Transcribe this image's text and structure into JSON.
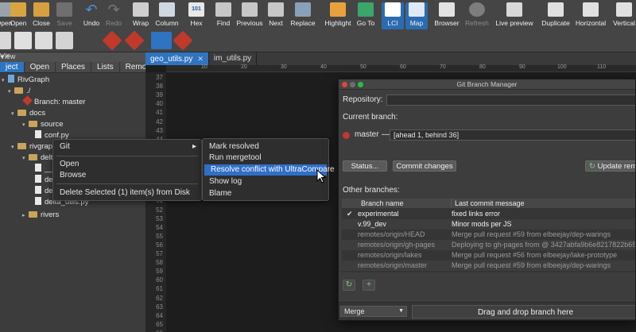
{
  "toolbar": {
    "items": [
      {
        "label": "Open",
        "icon": "open-folder-icon"
      },
      {
        "label": "Open",
        "icon": "open-folder-icon"
      },
      {
        "label": "Close",
        "icon": "close-folder-icon"
      },
      {
        "label": "Save",
        "icon": "save-icon"
      },
      {
        "label": "Undo",
        "icon": "undo-icon"
      },
      {
        "label": "Redo",
        "icon": "redo-icon"
      },
      {
        "label": "Wrap",
        "icon": "wrap-icon"
      },
      {
        "label": "Column",
        "icon": "column-icon"
      },
      {
        "label": "Hex",
        "icon": "hex-icon"
      },
      {
        "label": "Find",
        "icon": "binoculars-icon"
      },
      {
        "label": "Previous",
        "icon": "find-previous-icon"
      },
      {
        "label": "Next",
        "icon": "find-next-icon"
      },
      {
        "label": "Replace",
        "icon": "replace-icon"
      },
      {
        "label": "Highlight",
        "icon": "highlight-icon"
      },
      {
        "label": "Go To",
        "icon": "goto-icon"
      },
      {
        "label": "LCI",
        "icon": "lci-icon"
      },
      {
        "label": "Map",
        "icon": "map-icon"
      },
      {
        "label": "Browser",
        "icon": "browser-icon"
      },
      {
        "label": "Refresh",
        "icon": "globe-refresh-icon"
      },
      {
        "label": "Live preview",
        "icon": "live-preview-icon"
      },
      {
        "label": "Duplicate",
        "icon": "duplicate-icon"
      },
      {
        "label": "Horizontal",
        "icon": "horizontal-split-icon"
      },
      {
        "label": "Vertical",
        "icon": "vertical-split-icon"
      }
    ]
  },
  "left_panel": {
    "header": "View",
    "tabs": [
      "ject",
      "Open",
      "Places",
      "Lists",
      "Remote"
    ],
    "tree": [
      {
        "label": "RivGraph",
        "kind": "root"
      },
      {
        "label": "./",
        "kind": "folder"
      },
      {
        "label": "Branch: master",
        "kind": "git"
      },
      {
        "label": "docs",
        "kind": "folder"
      },
      {
        "label": "source",
        "kind": "folder"
      },
      {
        "label": "conf.py",
        "kind": "file"
      },
      {
        "label": "rivgraph",
        "kind": "folder"
      },
      {
        "label": "delta",
        "kind": "folder"
      },
      {
        "label": "__i",
        "kind": "file"
      },
      {
        "label": "delt",
        "kind": "file"
      },
      {
        "label": "delt",
        "kind": "file"
      },
      {
        "label": "delta_utils.py",
        "kind": "file"
      },
      {
        "label": "rivers",
        "kind": "folder"
      }
    ]
  },
  "editor": {
    "tabs": [
      {
        "label": "geo_utils.py",
        "active": true
      },
      {
        "label": "im_utils.py",
        "active": false
      }
    ],
    "ruler": [
      "10",
      "20",
      "30",
      "40",
      "50",
      "60",
      "70",
      "80",
      "90",
      "100",
      "110"
    ],
    "line_numbers": [
      "37",
      "38",
      "39",
      "40",
      "41",
      "42",
      "43",
      "44",
      "45",
      "46",
      "47",
      "48",
      "49",
      "50",
      "51",
      "52",
      "53",
      "54",
      "55",
      "56",
      "57",
      "58",
      "59",
      "60",
      "61",
      "62",
      "63",
      "64",
      "65",
      "66"
    ]
  },
  "context_menu": {
    "items": [
      "Git",
      "Open",
      "Browse",
      "Delete Selected (1) item(s) from Disk"
    ],
    "submenu_arrow": "▸"
  },
  "git_submenu": {
    "items": [
      "Mark resolved",
      "Run mergetool",
      "Resolve conflict with UltraCompare",
      "Show log",
      "Blame"
    ],
    "highlighted": "Resolve conflict with UltraCompare"
  },
  "git_window": {
    "title": "Git Branch Manager",
    "repository_label": "Repository:",
    "current_branch_label": "Current branch:",
    "current_branch": "master",
    "branch_sep": "—",
    "branch_status": "[ahead 1, behind 36]",
    "status_button": "Status...",
    "commit_button": "Commit changes",
    "update_button": "Update rem",
    "other_branches_label": "Other branches:",
    "columns": [
      "Branch name",
      "Last commit message"
    ],
    "branches": [
      {
        "name": "experimental",
        "message": "fixed links error",
        "checked": true,
        "remote": false
      },
      {
        "name": "v.99_dev",
        "message": "Minor mods per JS",
        "checked": false,
        "remote": false
      },
      {
        "name": "remotes/origin/HEAD",
        "message": "Merge pull request #59 from elbeejay/dep-warings",
        "checked": false,
        "remote": true
      },
      {
        "name": "remotes/origin/gh-pages",
        "message": "Deploying to gh-pages from  @ 3427abfa9b6e8217822b65",
        "checked": false,
        "remote": true
      },
      {
        "name": "remotes/origin/lakes",
        "message": "Merge pull request #56 from elbeejay/lake-prototype",
        "checked": false,
        "remote": true
      },
      {
        "name": "remotes/origin/master",
        "message": "Merge pull request #59 from elbeejay/dep-warings",
        "checked": false,
        "remote": true
      }
    ],
    "merge_select": "Merge",
    "drop_zone": "Drag and drop branch here",
    "refresh_icon": "↻",
    "add_icon": "+"
  }
}
